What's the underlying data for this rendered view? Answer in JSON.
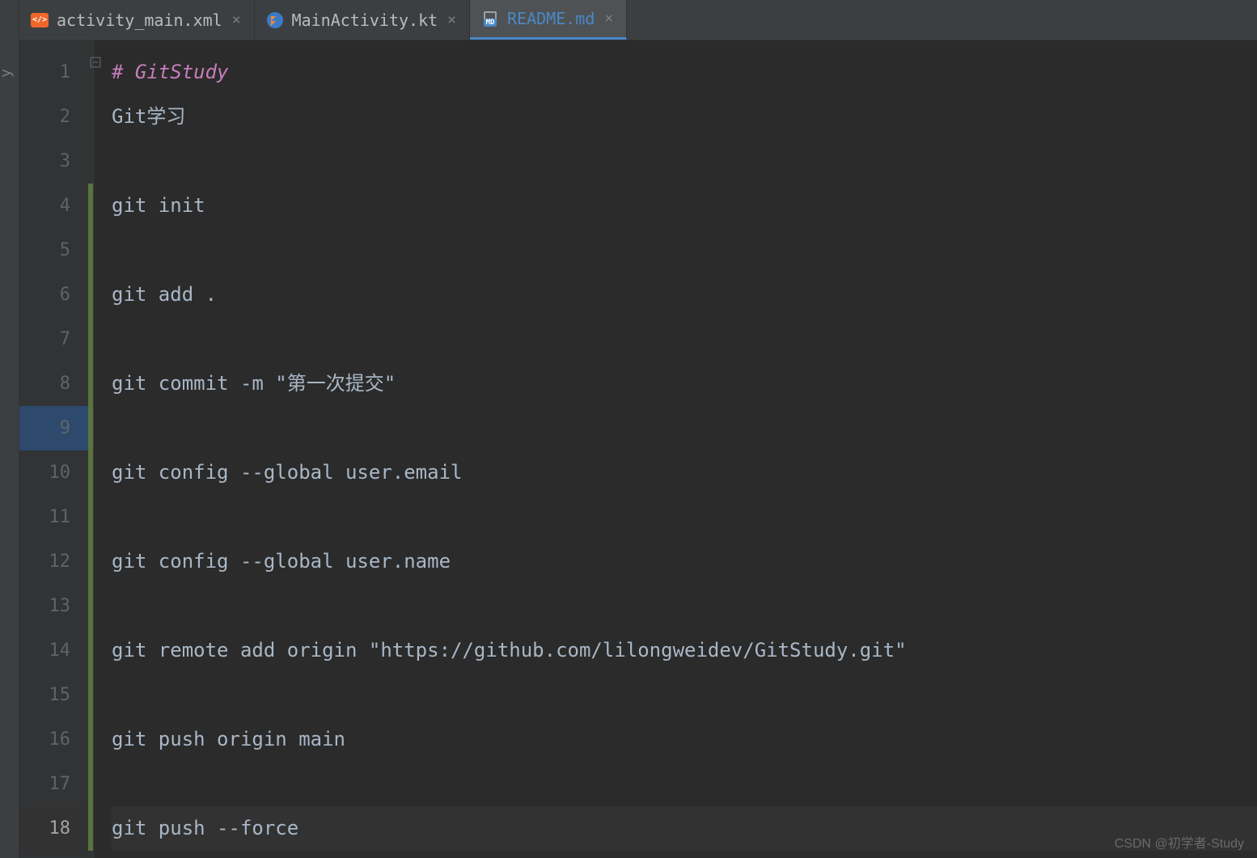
{
  "sidebar": {
    "label": "y"
  },
  "tabs": [
    {
      "label": "activity_main.xml",
      "active": false,
      "iconType": "xml"
    },
    {
      "label": "MainActivity.kt",
      "active": false,
      "iconType": "kt"
    },
    {
      "label": "README.md",
      "active": true,
      "iconType": "md"
    }
  ],
  "editor": {
    "currentLine": 18,
    "selectedGutterLine": 9,
    "lines": [
      {
        "num": 1,
        "content": "# GitStudy",
        "type": "heading"
      },
      {
        "num": 2,
        "content": "Git学习",
        "type": "text"
      },
      {
        "num": 3,
        "content": "",
        "type": "text"
      },
      {
        "num": 4,
        "content": "git init",
        "type": "text"
      },
      {
        "num": 5,
        "content": "",
        "type": "text"
      },
      {
        "num": 6,
        "content": "git add .",
        "type": "text"
      },
      {
        "num": 7,
        "content": "",
        "type": "text"
      },
      {
        "num": 8,
        "content": "git commit -m \"第一次提交\"",
        "type": "text"
      },
      {
        "num": 9,
        "content": "",
        "type": "text"
      },
      {
        "num": 10,
        "content": "git config --global user.email",
        "type": "text"
      },
      {
        "num": 11,
        "content": "",
        "type": "text"
      },
      {
        "num": 12,
        "content": "git config --global user.name",
        "type": "text"
      },
      {
        "num": 13,
        "content": "",
        "type": "text"
      },
      {
        "num": 14,
        "content": "git remote add origin \"https://github.com/lilongweidev/GitStudy.git\"",
        "type": "text"
      },
      {
        "num": 15,
        "content": "",
        "type": "text"
      },
      {
        "num": 16,
        "content": "git push origin main",
        "type": "text"
      },
      {
        "num": 17,
        "content": "",
        "type": "text"
      },
      {
        "num": 18,
        "content": "git push --force",
        "type": "text"
      }
    ],
    "changeMarker": {
      "startLine": 4,
      "endLine": 18
    }
  },
  "watermark": "CSDN @初学者-Study",
  "mdIconLabel": "MD"
}
